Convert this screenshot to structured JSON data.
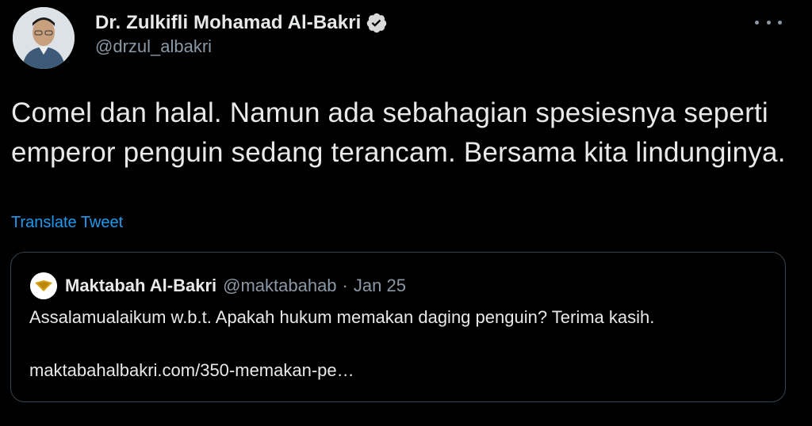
{
  "author": {
    "display_name": "Dr. Zulkifli Mohamad Al-Bakri",
    "handle": "@drzul_albakri",
    "verified_icon": "verified-badge-icon",
    "avatar_icon": "user-avatar"
  },
  "more_menu": {
    "icon": "more-options-icon"
  },
  "tweet": {
    "text": "Comel dan halal. Namun ada sebahagian spesiesnya seperti emperor penguin sedang terancam. Bersama kita lindunginya.",
    "translate_label": "Translate Tweet"
  },
  "quoted": {
    "display_name": "Maktabah Al-Bakri",
    "handle": "@maktabahab",
    "separator": "·",
    "date": "Jan 25",
    "text": "Assalamualaikum w.b.t. Apakah hukum memakan daging penguin? Terima kasih.",
    "link": "maktabahalbakri.com/350-memakan-pe…"
  },
  "colors": {
    "background": "#000000",
    "primary_text": "#e7e9ea",
    "secondary_text": "#8b98a5",
    "link_blue": "#1d9bf0",
    "border": "#38444d",
    "verified_badge": "#d9d9d9"
  }
}
